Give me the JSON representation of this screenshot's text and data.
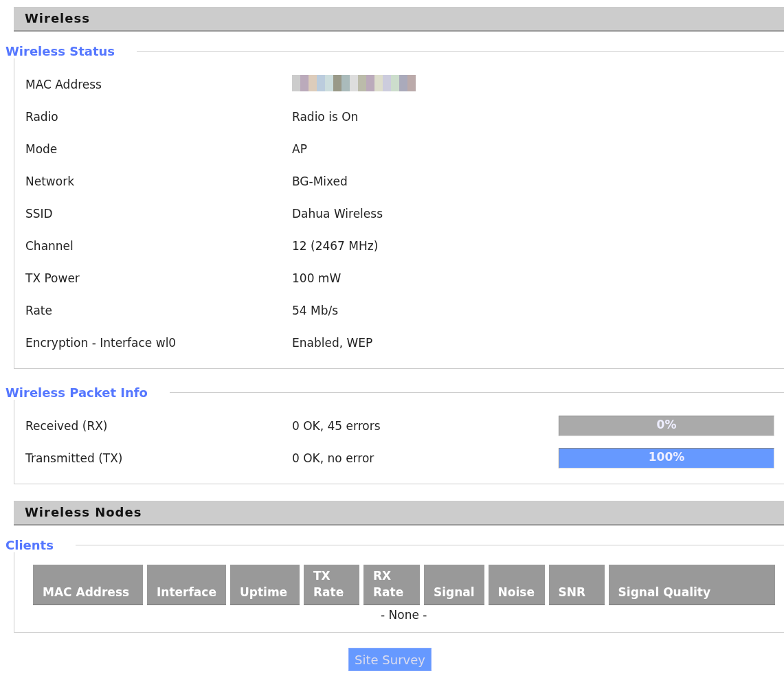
{
  "sections": [
    {
      "kind": "status",
      "header": "Wireless",
      "legend": "Wireless Status",
      "rows": [
        {
          "label": "MAC Address",
          "kind": "blurred"
        },
        {
          "label": "Radio",
          "value": "Radio is On"
        },
        {
          "label": "Mode",
          "value": "AP"
        },
        {
          "label": "Network",
          "value": "BG-Mixed"
        },
        {
          "label": "SSID",
          "value": "Dahua Wireless"
        },
        {
          "label": "Channel",
          "value": "12 (2467 MHz)"
        },
        {
          "label": "TX Power",
          "value": "100 mW"
        },
        {
          "label": "Rate",
          "value": "54 Mb/s"
        },
        {
          "label": "Encryption - Interface wl0",
          "value": "Enabled, WEP"
        }
      ]
    },
    {
      "kind": "packets",
      "legend": "Wireless Packet Info",
      "rows": [
        {
          "label": "Received (RX)",
          "value": "0 OK, 45 errors",
          "level": 0,
          "reading": "0%"
        },
        {
          "label": "Transmitted (TX)",
          "value": "0 OK, no error",
          "level": 1,
          "reading": "100%"
        }
      ]
    },
    {
      "kind": "clients",
      "header": "Wireless Nodes",
      "legend": "Clients",
      "columns": [
        {
          "lines": [
            "MAC Address"
          ]
        },
        {
          "lines": [
            "Interface"
          ]
        },
        {
          "lines": [
            "Uptime"
          ]
        },
        {
          "lines": [
            "TX",
            "Rate"
          ]
        },
        {
          "lines": [
            "RX",
            "Rate"
          ]
        },
        {
          "lines": [
            "Signal"
          ]
        },
        {
          "lines": [
            "Noise"
          ]
        },
        {
          "lines": [
            "SNR"
          ]
        },
        {
          "lines": [
            "Signal Quality"
          ]
        }
      ],
      "empty_text": "- None -"
    }
  ],
  "button": "Site Survey"
}
